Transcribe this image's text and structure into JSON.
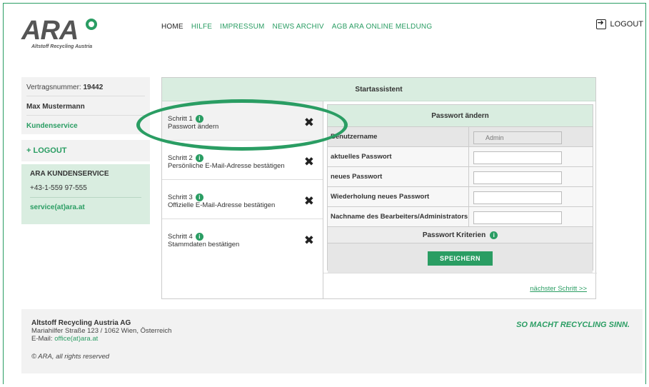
{
  "brand": {
    "logo_text": "ARA",
    "logo_subtitle": "Altstoff Recycling Austria",
    "accent_color": "#2a9d63"
  },
  "nav": {
    "items": [
      "HOME",
      "HILFE",
      "IMPRESSUM",
      "NEWS ARCHIV",
      "AGB ARA ONLINE MELDUNG"
    ],
    "active": "HOME",
    "logout": "LOGOUT"
  },
  "sidebar": {
    "contract_label": "Vertragsnummer:",
    "contract_number": "19442",
    "user_name": "Max Mustermann",
    "customer_service_link": "Kundenservice",
    "logout": "+ LOGOUT",
    "service_box": {
      "title": "ARA KUNDENSERVICE",
      "phone": "+43-1-559 97-555",
      "email": "service(at)ara.at"
    }
  },
  "wizard": {
    "title": "Startassistent",
    "steps": [
      {
        "number": "Schritt 1",
        "label": "Passwort ändern"
      },
      {
        "number": "Schritt 2",
        "label": "Persönliche E-Mail-Adresse bestätigen"
      },
      {
        "number": "Schritt 3",
        "label": "Offizielle E-Mail-Adresse bestätigen"
      },
      {
        "number": "Schritt 4",
        "label": "Stammdaten bestätigen"
      }
    ],
    "panel": {
      "title": "Passwort ändern",
      "fields": [
        {
          "label": "Benutzername",
          "value": "Admin",
          "readonly": true
        },
        {
          "label": "aktuelles Passwort",
          "value": "",
          "readonly": false
        },
        {
          "label": "neues Passwort",
          "value": "",
          "readonly": false
        },
        {
          "label": "Wiederholung neues Passwort",
          "value": "",
          "readonly": false
        },
        {
          "label": "Nachname des Bearbeiters/Administrators",
          "value": "",
          "readonly": false
        }
      ],
      "criteria": "Passwort Kriterien",
      "save": "SPEICHERN"
    },
    "next": "nächster Schritt >>"
  },
  "footer": {
    "company": "Altstoff Recycling Austria AG",
    "address": "Mariahilfer Straße 123 / 1062 Wien, Österreich",
    "email_label": "E-Mail:",
    "email": "office(at)ara.at",
    "copyright": "© ARA, all rights reserved",
    "slogan": "SO MACHT RECYCLING SINN."
  }
}
